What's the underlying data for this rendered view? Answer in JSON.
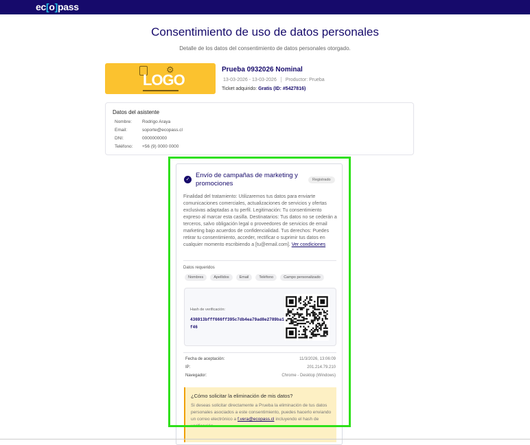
{
  "brand": {
    "name_start": "ec",
    "name_mid": "o",
    "name_end": "pass",
    "accent": "#160a6b"
  },
  "header": {
    "title": "Consentimiento de uso de datos personales",
    "subtitle": "Detalle de los datos del consentimiento de datos personales otorgado."
  },
  "event": {
    "logo_text": "LOGO",
    "title": "Prueba 0932026 Nominal",
    "dates": "13-03-2026 - 13-03-2026",
    "producer": "Productor: Prueba",
    "ticket_label": "Ticket adquirido:",
    "ticket_value": "Gratis (ID: #5427816)"
  },
  "attendee": {
    "title": "Datos del asistente",
    "rows": [
      {
        "k": "Nombre:",
        "v": "Rodrigo Araya"
      },
      {
        "k": "Email:",
        "v": "soporte@ecopass.cl"
      },
      {
        "k": "DNI:",
        "v": "0000000000"
      },
      {
        "k": "Teléfono:",
        "v": "+56 (9) 0000 0000"
      }
    ]
  },
  "consent": {
    "title": "Envío de campañas de marketing y promociones",
    "badge": "Registrado",
    "description": "Finalidad del tratamiento: Utilizaremos tus datos para enviarte comunicaciones comerciales, actualizaciones de servicios y ofertas exclusivas adaptadas a tu perfil. Legitimación: Tu consentimiento expreso al marcar esta casilla. Destinatarios: Tus datos no se cederán a terceros, salvo obligación legal o proveedores de servicios de email marketing bajo acuerdos de confidencialidad. Tus derechos: Puedes retirar tu consentimiento, acceder, rectificar o suprimir tus datos en cualquier momento escribiendo a [tu@email.com].",
    "link": "Ver condiciones",
    "required_label": "Datos requeridos",
    "chips": [
      "Nombres",
      "Apellidos",
      "Email",
      "Teléfono",
      "Campo personalizado"
    ],
    "hash_label": "Hash de verificación:",
    "hash": "436913bfff666ff395c7db4ea79ad8e2789ba1f46",
    "meta": [
      {
        "k": "Fecha de aceptación:",
        "v": "11/3/2026, 13:06:09"
      },
      {
        "k": "IP:",
        "v": "201.214.79.210"
      },
      {
        "k": "Navegador:",
        "v": "Chrome - Desktop (Windows)"
      }
    ],
    "deletion": {
      "title": "¿Cómo solicitar la eliminación de mis datos?",
      "text": "Si deseas solicitar directamente a Prueba la eliminación de tus datos personales asociados a este consentimiento, puedes hacerlo enviando un correo electrónico a",
      "email": "f.vera@ecopass.cl",
      "text_end": "incluyendo el hash de verificación."
    }
  }
}
